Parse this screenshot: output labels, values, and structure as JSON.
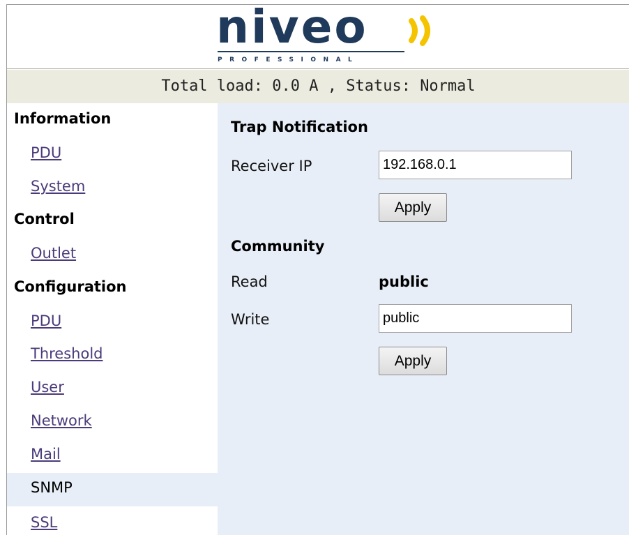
{
  "header": {
    "logo_text": "niveo",
    "logo_subtitle": "PROFESSIONAL",
    "brand_color": "#1f3a5a",
    "accent_color": "#f5c400"
  },
  "status": {
    "text": "Total load: 0.0 A , Status: Normal"
  },
  "sidebar": {
    "information_title": "Information",
    "information_items": [
      "PDU",
      "System"
    ],
    "control_title": "Control",
    "control_items": [
      "Outlet"
    ],
    "configuration_title": "Configuration",
    "configuration_items": [
      "PDU",
      "Threshold",
      "User",
      "Network",
      "Mail",
      "SNMP",
      "SSL"
    ],
    "active_item": "SNMP"
  },
  "main": {
    "trap_title": "Trap Notification",
    "receiver_ip_label": "Receiver IP",
    "receiver_ip_value": "192.168.0.1",
    "apply_label": "Apply",
    "community_title": "Community",
    "read_label": "Read",
    "read_value": "public",
    "write_label": "Write",
    "write_value": "public"
  }
}
